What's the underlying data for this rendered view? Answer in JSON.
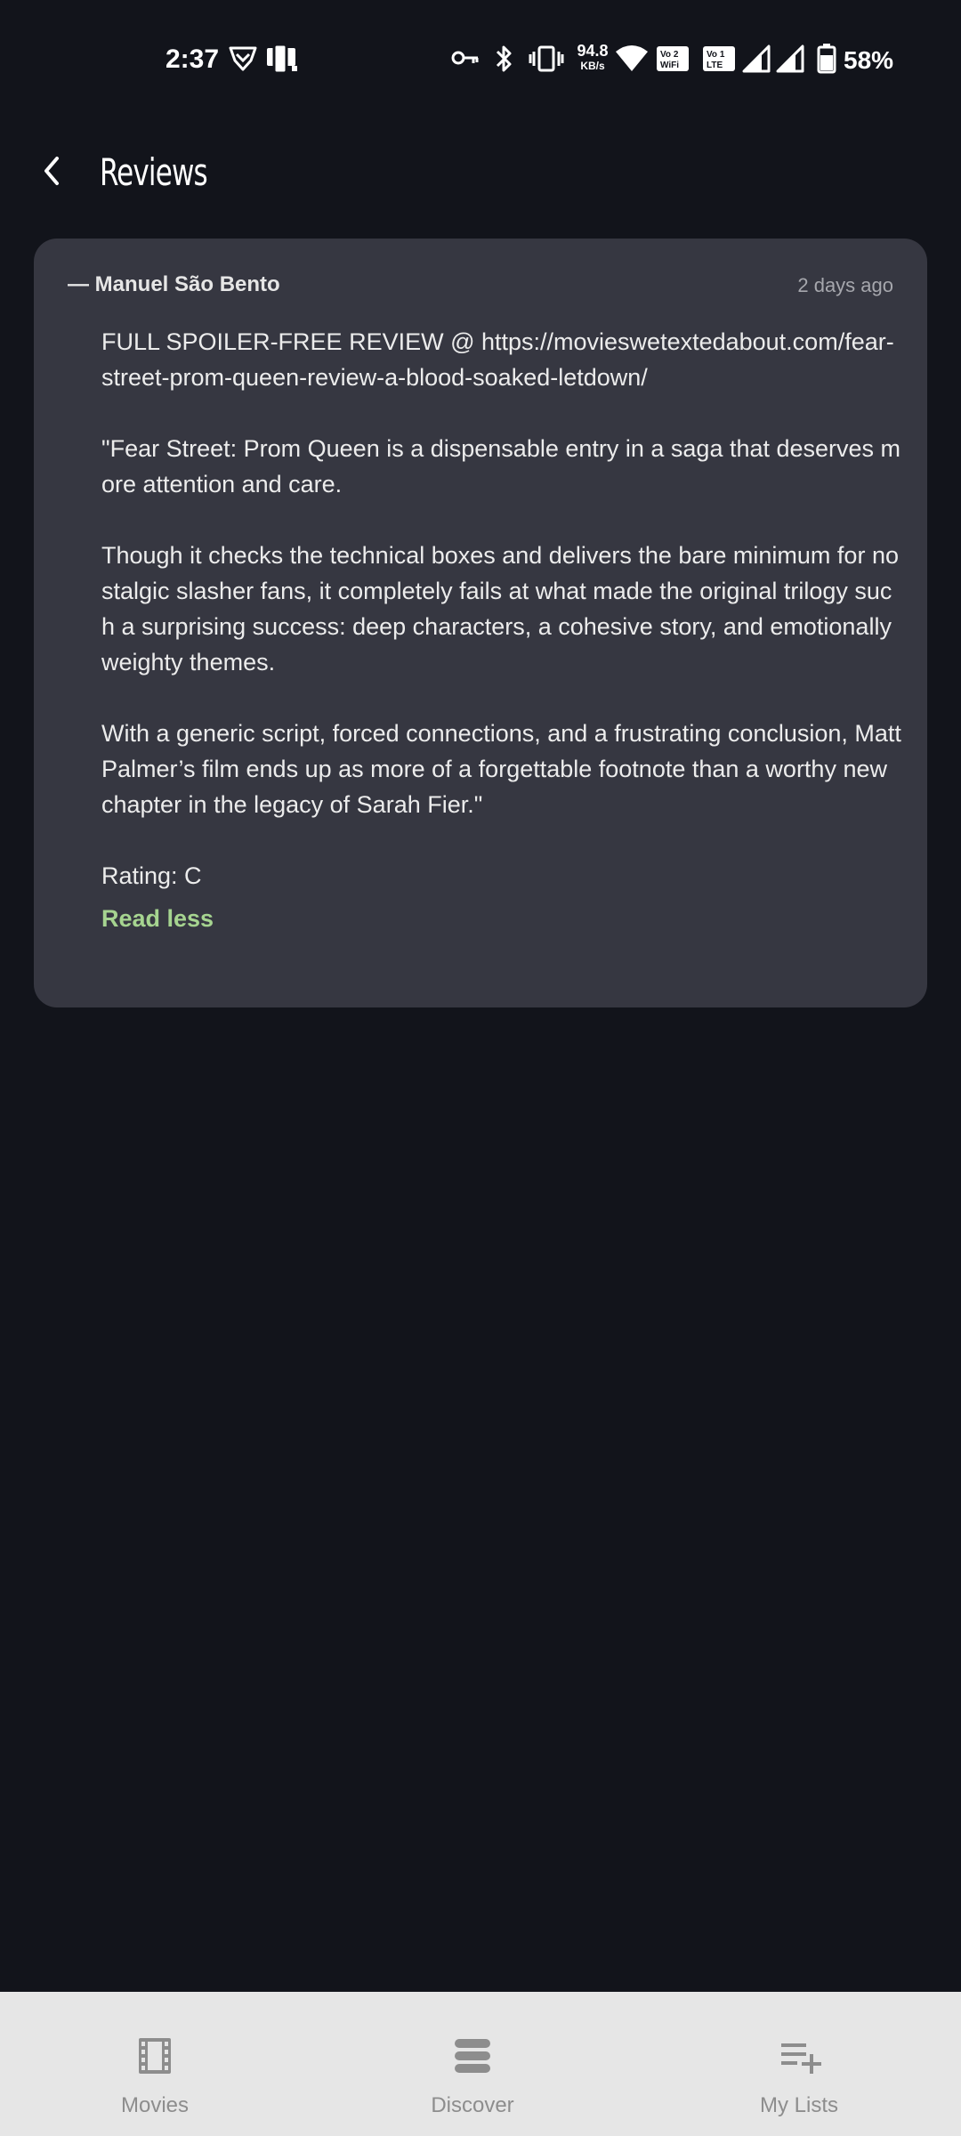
{
  "status_bar": {
    "time": "2:37",
    "net_speed_value": "94.8",
    "net_speed_unit": "KB/s",
    "battery": "58%",
    "icons": [
      "shield-check-icon",
      "phone-link-icon",
      "vpn-key-icon",
      "bluetooth-icon",
      "vibrate-icon",
      "wifi-icon",
      "vowifi-icon",
      "volte-icon",
      "signal-icon",
      "signal-icon",
      "battery-icon"
    ],
    "vowifi_label": "Vo 2 WiFi",
    "volte_label": "Vo 1 LTE"
  },
  "header": {
    "title": "Reviews"
  },
  "review": {
    "author": "— Manuel São Bento",
    "date": "2 days ago",
    "paragraphs": [
      "FULL SPOILER-FREE REVIEW @ https://movieswetextedabout.com/fear-street-prom-queen-review-a-blood-soaked-letdown/",
      "\"Fear Street: Prom Queen is a dispensable entry in a saga that deserves more attention and care.",
      "Though it checks the technical boxes and delivers the bare minimum for nostalgic slasher fans, it completely fails at what made the original trilogy such a surprising success: deep characters, a cohesive story, and emotionally weighty themes.",
      "With a generic script, forced connections, and a frustrating conclusion, Matt Palmer’s film ends up as more of a forgettable footnote than a worthy new chapter in the legacy of Sarah Fier.\"",
      "Rating: C"
    ],
    "toggle_label": "Read less"
  },
  "bottom_nav": {
    "items": [
      {
        "label": "Movies",
        "icon": "film-icon"
      },
      {
        "label": "Discover",
        "icon": "stack-icon"
      },
      {
        "label": "My Lists",
        "icon": "playlist-add-icon"
      }
    ]
  },
  "colors": {
    "background": "#12141b",
    "card": "#363741",
    "accent_green": "#a6d490",
    "nav_background": "#e6e6e6",
    "nav_text": "#8d8d8d"
  }
}
